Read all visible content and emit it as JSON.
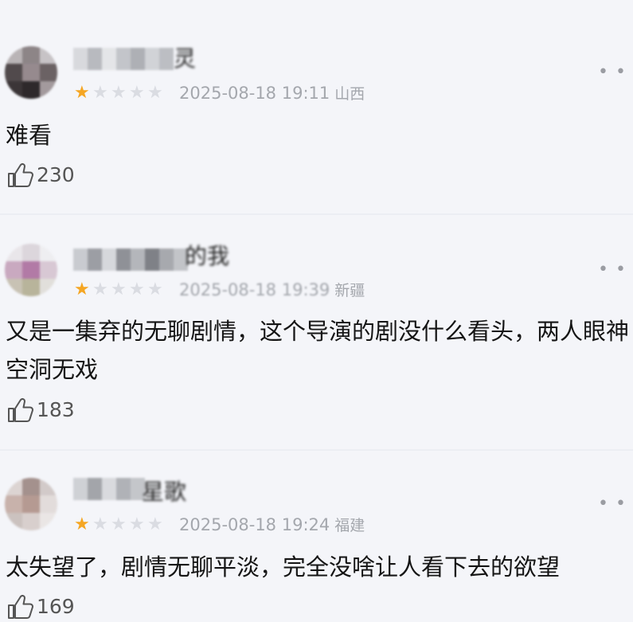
{
  "comments": [
    {
      "username_tail": "灵",
      "rating": 1,
      "rating_max": 5,
      "date": "2025-08-18 19:11",
      "region": "山西",
      "text": "难看",
      "likes": "230",
      "more_icon": "more-icon",
      "like_icon": "thumbs-up-icon"
    },
    {
      "username_tail": "的我",
      "rating": 1,
      "rating_max": 5,
      "date": "2025-08-18 19:39",
      "region": "新疆",
      "text": "又是一集弃的无聊剧情，这个导演的剧没什么看头，两人眼神空洞无戏",
      "likes": "183",
      "more_icon": "more-icon",
      "like_icon": "thumbs-up-icon"
    },
    {
      "username_tail": "星歌",
      "rating": 1,
      "rating_max": 5,
      "date": "2025-08-18 19:24",
      "region": "福建",
      "text": "太失望了，剧情无聊平淡，完全没啥让人看下去的欲望",
      "likes": "169",
      "more_icon": "more-icon",
      "like_icon": "thumbs-up-icon"
    }
  ],
  "colors": {
    "star_filled": "#f5a623",
    "star_empty": "#dadce2",
    "meta_text": "#a4a7ad",
    "background": "#f4f5f9"
  }
}
